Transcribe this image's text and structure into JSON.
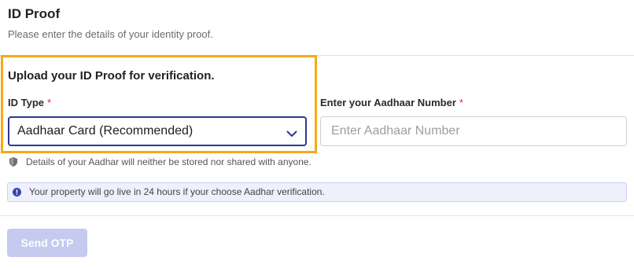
{
  "page": {
    "title": "ID Proof",
    "subtitle": "Please enter the details of your identity proof."
  },
  "upload_section": {
    "heading": "Upload your ID Proof for verification."
  },
  "id_type": {
    "label": "ID Type",
    "required_mark": "*",
    "selected_value": "Aadhaar Card (Recommended)",
    "icon": "chevron-down-icon"
  },
  "aadhaar_number": {
    "label": "Enter your Aadhaar Number",
    "required_mark": "*",
    "value": "",
    "placeholder": "Enter Aadhaar Number"
  },
  "privacy_note": {
    "icon": "shield-icon",
    "text": "Details of your Aadhar will neither be stored nor shared with anyone."
  },
  "info_banner": {
    "icon": "info-icon",
    "text": "Your property will go live in 24 hours if your choose Aadhar verification."
  },
  "actions": {
    "send_otp_label": "Send OTP",
    "send_otp_disabled": true
  },
  "colors": {
    "highlight": "#f6a918",
    "accent": "#2e3990",
    "required": "#e0262a",
    "info_icon": "#3744b3",
    "info_bg": "#eef0fb",
    "button_disabled_bg": "#c5caee"
  }
}
